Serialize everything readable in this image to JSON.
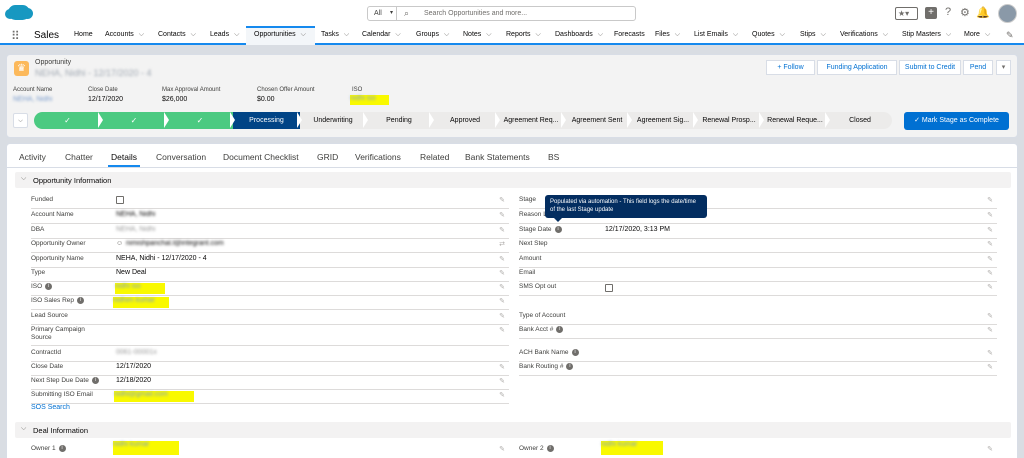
{
  "header": {
    "search_scope": "All",
    "search_placeholder": "Search Opportunities and more..."
  },
  "nav": {
    "app_name": "Sales",
    "items": [
      "Home",
      "Accounts",
      "Contacts",
      "Leads",
      "Opportunities",
      "Tasks",
      "Calendar",
      "Groups",
      "Notes",
      "Reports",
      "Dashboards",
      "Forecasts",
      "Files",
      "List Emails",
      "Quotes",
      "Stips",
      "Verifications",
      "Stip Masters",
      "More"
    ]
  },
  "record": {
    "object_label": "Opportunity",
    "name": "NEHA, Nidhi - 12/17/2020 - 4",
    "buttons": {
      "follow": "+ Follow",
      "funding": "Funding Application",
      "submit": "Submit to Credit",
      "pend": "Pend"
    },
    "highlights": [
      {
        "label": "Account Name",
        "value": "NEHA, Nidhi"
      },
      {
        "label": "Close Date",
        "value": "12/17/2020"
      },
      {
        "label": "Max Approval Amount",
        "value": "$26,000"
      },
      {
        "label": "Chosen Offer Amount",
        "value": "$0.00"
      },
      {
        "label": "ISO",
        "value": "nidhi iso"
      }
    ]
  },
  "path": {
    "stages": [
      "Processing",
      "Underwriting",
      "Pending",
      "Approved",
      "Agreement Req...",
      "Agreement Sent",
      "Agreement Sig...",
      "Renewal Prosp...",
      "Renewal Reque...",
      "Closed"
    ],
    "mark_button": "✓ Mark Stage as Complete"
  },
  "tabs": [
    "Activity",
    "Chatter",
    "Details",
    "Conversation",
    "Document Checklist",
    "GRID",
    "Verifications",
    "Related",
    "Bank Statements",
    "BS"
  ],
  "section1": {
    "title": "Opportunity Information",
    "left": [
      {
        "label": "Funded",
        "value": ""
      },
      {
        "label": "Account Name",
        "value": "NEHA, Nidhi"
      },
      {
        "label": "DBA",
        "value": "NEHA, Nidhi"
      },
      {
        "label": "Opportunity Owner",
        "value": "nimishpanchal.l@integrant.com"
      },
      {
        "label": "Opportunity Name",
        "value": "NEHA, Nidhi - 12/17/2020 - 4"
      },
      {
        "label": "Type",
        "value": "New Deal"
      },
      {
        "label": "ISO",
        "value": "nidhi iso"
      },
      {
        "label": "ISO Sales Rep",
        "value": "nidhim kumar"
      },
      {
        "label": "Lead Source",
        "value": ""
      },
      {
        "label": "Primary Campaign Source",
        "value": ""
      },
      {
        "label": "ContractId",
        "value": "0061-00001x"
      },
      {
        "label": "Close Date",
        "value": "12/17/2020"
      },
      {
        "label": "Next Step Due Date",
        "value": "12/18/2020"
      },
      {
        "label": "Submitting ISO Email",
        "value": "nidhi@gmail.com"
      }
    ],
    "sos_link": "SOS Search",
    "right": [
      {
        "label": "Stage",
        "value": ""
      },
      {
        "label": "Reason Lost",
        "value": ""
      },
      {
        "label": "Stage Date",
        "value": "12/17/2020, 3:13 PM"
      },
      {
        "label": "Next Step",
        "value": ""
      },
      {
        "label": "Amount",
        "value": ""
      },
      {
        "label": "Email",
        "value": ""
      },
      {
        "label": "SMS Opt out",
        "value": ""
      },
      {
        "label": "Type of Account",
        "value": ""
      },
      {
        "label": "Bank Acct #",
        "value": ""
      },
      {
        "label": "ACH Bank Name",
        "value": ""
      },
      {
        "label": "Bank Routing #",
        "value": ""
      }
    ],
    "tooltip": "Populated via automation - This field logs the date/time of the last Stage update"
  },
  "section2": {
    "title": "Deal Information",
    "owner1_label": "Owner 1",
    "owner1_value": "nidhi kumar",
    "owner2_label": "Owner 2",
    "owner2_value": "nidhi kumar"
  }
}
